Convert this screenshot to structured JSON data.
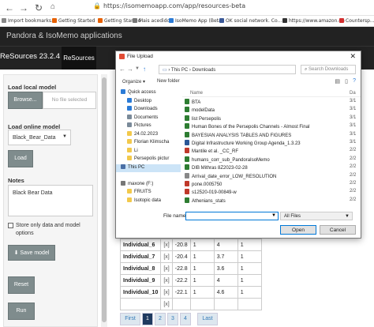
{
  "browser": {
    "url": "https://isomemoapp.com/app/resources-beta",
    "bookmarks": [
      {
        "label": "Import bookmarks...",
        "color": "#888888"
      },
      {
        "label": "Getting Started",
        "color": "#e66000"
      },
      {
        "label": "Getting Started",
        "color": "#e66000"
      },
      {
        "label": "Mais acedidos",
        "color": "#777777"
      },
      {
        "label": "IsoMemo App (Beta)",
        "color": "#2b7bd6"
      },
      {
        "label": "OK social network. Co...",
        "color": "#3b5998"
      },
      {
        "label": "https://www.amazon.de",
        "color": "#333333"
      },
      {
        "label": "Countersp...",
        "color": "#d32f2f"
      }
    ]
  },
  "app": {
    "title": "Pandora & IsoMemo applications",
    "brand": "ReSources 23.2.4",
    "tab": "ReSources"
  },
  "sidebar": {
    "load_local_label": "Load local model",
    "browse_label": "Browse...",
    "no_file": "No file selected",
    "load_online_label": "Load online model",
    "online_model": "Black_Bear_Data",
    "load_button": "Load",
    "notes_label": "Notes",
    "notes_value": "Black Bear Data",
    "store_only_label": "Store only data and model options",
    "save_model": "Save model",
    "reset": "Reset",
    "run": "Run"
  },
  "table": {
    "rows": [
      {
        "name": "Individual_6",
        "x": "[x]",
        "a": "-20.8",
        "b": "1",
        "c": "4",
        "d": "1"
      },
      {
        "name": "Individual_7",
        "x": "[x]",
        "a": "-20.4",
        "b": "1",
        "c": "3.7",
        "d": "1"
      },
      {
        "name": "Individual_8",
        "x": "[x]",
        "a": "-22.8",
        "b": "1",
        "c": "3.6",
        "d": "1"
      },
      {
        "name": "Individual_9",
        "x": "[x]",
        "a": "-22.2",
        "b": "1",
        "c": "4",
        "d": "1"
      },
      {
        "name": "Individual_10",
        "x": "[x]",
        "a": "-22.1",
        "b": "1",
        "c": "4.6",
        "d": "1"
      },
      {
        "name": "",
        "x": "[x]",
        "a": "",
        "b": "",
        "c": "",
        "d": ""
      }
    ]
  },
  "pager": {
    "first": "First",
    "pages": [
      "1",
      "2",
      "3",
      "4"
    ],
    "last": "Last"
  },
  "dialog": {
    "title": "File Upload",
    "close": "✕",
    "path_root": "This PC",
    "path_sep": "›",
    "path_folder": "Downloads",
    "search_placeholder": "Search Downloads",
    "organize": "Organize ▾",
    "new_folder": "New folder",
    "list_header_name": "Name",
    "list_header_date": "Da",
    "tree": [
      {
        "label": "Quick access",
        "color": "#2b7bd6",
        "indent": 0
      },
      {
        "label": "Desktop",
        "color": "#2b7bd6",
        "indent": 1
      },
      {
        "label": "Downloads",
        "color": "#2b7bd6",
        "indent": 1
      },
      {
        "label": "Documents",
        "color": "#7a8a99",
        "indent": 1
      },
      {
        "label": "Pictures",
        "color": "#7a8a99",
        "indent": 1
      },
      {
        "label": "24.02.2023",
        "color": "#f2c94c",
        "indent": 1
      },
      {
        "label": "Florian Klimscha",
        "color": "#f2c94c",
        "indent": 1
      },
      {
        "label": "Li",
        "color": "#f2c94c",
        "indent": 1
      },
      {
        "label": "Persepolis pictur",
        "color": "#f2c94c",
        "indent": 1
      },
      {
        "label": "This PC",
        "color": "#4a6fa5",
        "indent": 0,
        "selected": true
      },
      {
        "label": "",
        "color": "#ffffff",
        "indent": 0
      },
      {
        "label": "maxone (F:)",
        "color": "#777777",
        "indent": 0
      },
      {
        "label": "FRUITS",
        "color": "#f2c94c",
        "indent": 1
      },
      {
        "label": "Isotopic data",
        "color": "#f2c94c",
        "indent": 1
      }
    ],
    "files": [
      {
        "name": "BTA",
        "color": "#2e7d32",
        "date": "3/1"
      },
      {
        "name": "modelData",
        "color": "#2e7d32",
        "date": "3/1"
      },
      {
        "name": "list Persepolis",
        "color": "#2e7d32",
        "date": "3/1"
      },
      {
        "name": "Human Bones of the Persepolis Channels - Almost Final",
        "color": "#2e7d32",
        "date": "3/1"
      },
      {
        "name": "BAYESIAN ANALYSIS TABLES AND FIGURES",
        "color": "#2e7d32",
        "date": "3/1"
      },
      {
        "name": "Digital Infrastructure Working Group Agenda_1.3.23",
        "color": "#2b5797",
        "date": "3/1"
      },
      {
        "name": "Mantile et al. _CC_RF",
        "color": "#c0392b",
        "date": "2/2"
      },
      {
        "name": "humans_corr_sub_PandoraIsoMemo",
        "color": "#2e7d32",
        "date": "2/2"
      },
      {
        "name": "DIB Mithras 8Z2023-02-28",
        "color": "#2e7d32",
        "date": "2/2"
      },
      {
        "name": "Arrival_date_error_LOW_RESOLUTION",
        "color": "#888888",
        "date": "2/2"
      },
      {
        "name": "pone.0005750",
        "color": "#c0392b",
        "date": "2/2"
      },
      {
        "name": "s12520-019-00849-w",
        "color": "#c0392b",
        "date": "2/2"
      },
      {
        "name": "Athenians_stats",
        "color": "#2e7d32",
        "date": "2/2"
      }
    ],
    "file_name_label": "File name:",
    "file_type": "All Files",
    "open": "Open",
    "cancel": "Cancel"
  }
}
